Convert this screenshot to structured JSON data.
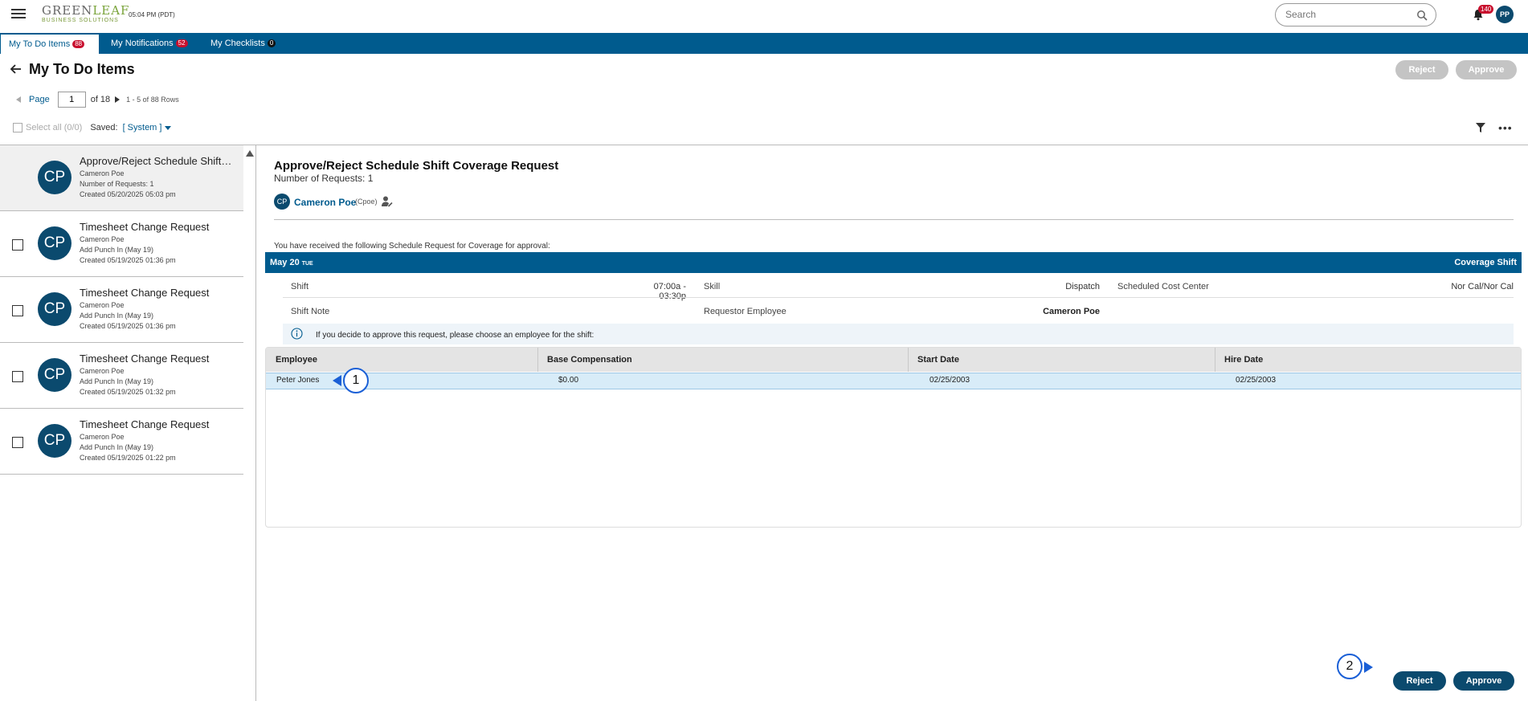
{
  "app": {
    "logo_main": "GREEN",
    "logo_leaf": "LEAF",
    "logo_sub": "BUSINESS SOLUTIONS",
    "time": "05:04 PM (PDT)",
    "search_placeholder": "Search",
    "notification_count": "140",
    "user_initials": "PP"
  },
  "tabs": [
    {
      "label": "My To Do Items",
      "count": "88",
      "active": true
    },
    {
      "label": "My Notifications",
      "count": "52",
      "active": false
    },
    {
      "label": "My Checklists",
      "count": "0",
      "active": false
    }
  ],
  "header": {
    "title": "My To Do Items",
    "reject_label": "Reject",
    "approve_label": "Approve"
  },
  "pager": {
    "page_label": "Page",
    "current_page": "1",
    "of_total": "of 18",
    "rows_info": "1 - 5 of 88 Rows"
  },
  "filter_bar": {
    "select_all": "Select all (0/0)",
    "saved_label": "Saved:",
    "saved_value": "[ System ]"
  },
  "list_items": [
    {
      "initials": "CP",
      "title": "Approve/Reject Schedule Shift ...",
      "line1": "Cameron Poe",
      "line2": "Number of Requests: 1",
      "line3": "Created 05/20/2025 05:03 pm"
    },
    {
      "initials": "CP",
      "title": "Timesheet Change Request",
      "line1": "Cameron Poe",
      "line2": "Add Punch In (May 19)",
      "line3": "Created 05/19/2025 01:36 pm"
    },
    {
      "initials": "CP",
      "title": "Timesheet Change Request",
      "line1": "Cameron Poe",
      "line2": "Add Punch In (May 19)",
      "line3": "Created 05/19/2025 01:36 pm"
    },
    {
      "initials": "CP",
      "title": "Timesheet Change Request",
      "line1": "Cameron Poe",
      "line2": "Add Punch In (May 19)",
      "line3": "Created 05/19/2025 01:32 pm"
    },
    {
      "initials": "CP",
      "title": "Timesheet Change Request",
      "line1": "Cameron Poe",
      "line2": "Add Punch In (May 19)",
      "line3": "Created 05/19/2025 01:22 pm"
    }
  ],
  "detail": {
    "title": "Approve/Reject Schedule Shift Coverage Request",
    "num_requests": "Number of Requests: 1",
    "requester_initials": "CP",
    "requester_name": "Cameron Poe",
    "requester_user": "(Cpoe)",
    "received_text": "You have received the following Schedule Request for Coverage for approval:",
    "date": "May 20",
    "day_of_week": "TUE",
    "coverage_label": "Coverage Shift",
    "shift_label": "Shift",
    "shift_value": "07:00a - 03:30p",
    "skill_label": "Skill",
    "skill_value": "Dispatch",
    "cost_center_label": "Scheduled Cost Center",
    "cost_center_value": "Nor Cal/Nor Cal",
    "shift_note_label": "Shift Note",
    "requestor_label": "Requestor Employee",
    "requestor_value": "Cameron Poe",
    "info_text": "If you decide to approve this request, please choose an employee for the shift:",
    "grid": {
      "headers": [
        "Employee",
        "Base Compensation",
        "Start Date",
        "Hire Date"
      ],
      "rows": [
        [
          "Peter Jones",
          "$0.00",
          "02/25/2003",
          "02/25/2003"
        ]
      ]
    },
    "reject_label": "Reject",
    "approve_label": "Approve"
  },
  "callouts": [
    "1",
    "2"
  ],
  "colors": {
    "primary": "#005b8e",
    "dark_button": "#0b4a6e",
    "badge": "#c8102e",
    "callout": "#1a5fd6"
  }
}
